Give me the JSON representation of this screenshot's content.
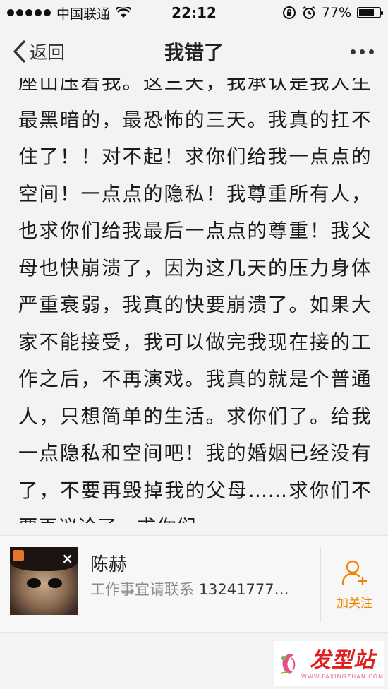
{
  "status_bar": {
    "carrier": "中国联通",
    "time": "22:12",
    "battery": "77%",
    "battery_level": 0.77
  },
  "nav": {
    "back_label": "返回",
    "title": "我错了"
  },
  "article": {
    "text": "座山压着我。这三天，我承认是我人生最黑暗的，最恐怖的三天。我真的扛不住了！！对不起！求你们给我一点点的空间！一点点的隐私！我尊重所有人，也求你们给我最后一点点的尊重！我父母也快崩溃了，因为这几天的压力身体严重衰弱，我真的快要崩溃了。如果大家不能接受，我可以做完我现在接的工作之后，不再演戏。我真的就是个普通人，只想简单的生活。求你们了。给我一点隐私和空间吧！我的婚姻已经没有了，不要再毁掉我的父母……求你们不要再议论了。求你们。。"
  },
  "author": {
    "name": "陈赫",
    "desc_prefix": "工作事宜请联系 ",
    "phone": "13241777…",
    "follow_label": "加关注"
  },
  "watermark": {
    "brand": "发型站",
    "url": "WWW.FAXINGZHAN.COM"
  },
  "colors": {
    "accent": "#f08300",
    "background": "#f3f3f3"
  }
}
